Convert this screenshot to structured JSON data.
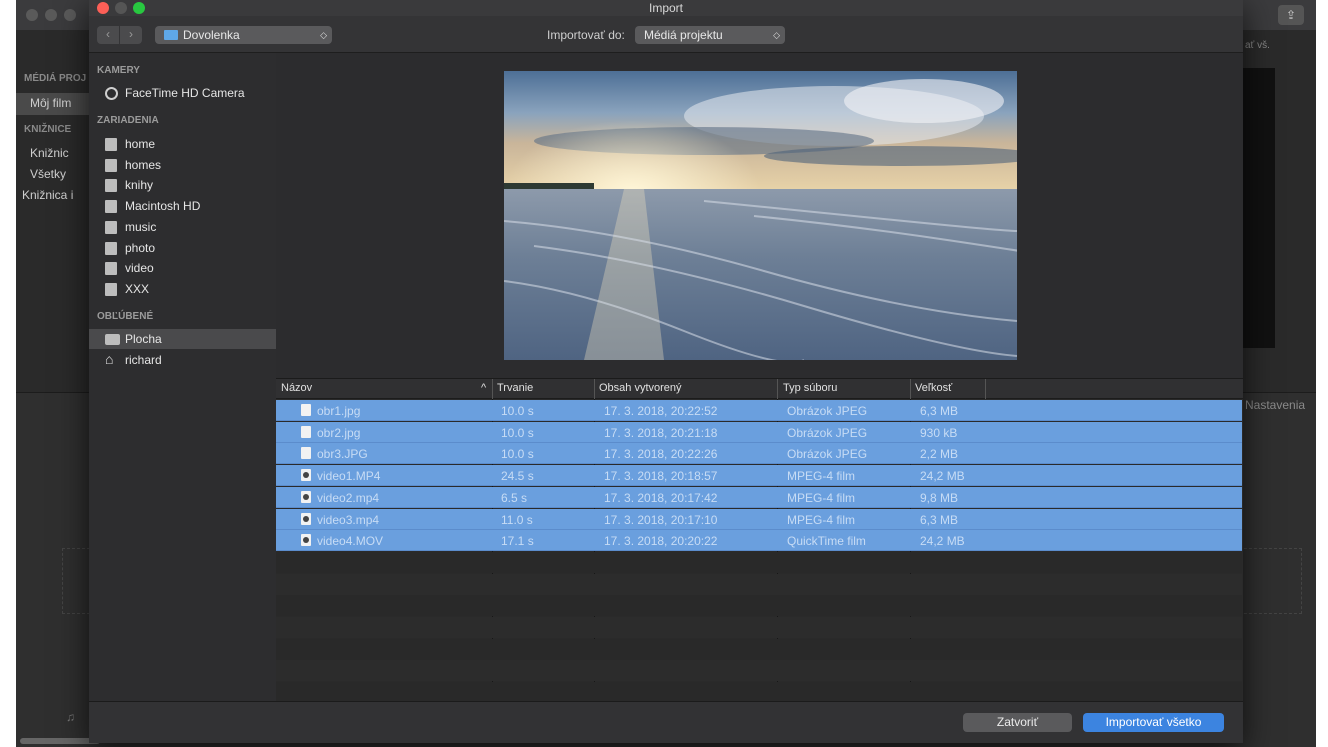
{
  "background_app": {
    "sidebar_sections": [
      "MÉDIÁ PROJ",
      "KNIŽNICE"
    ],
    "sidebar_items": [
      "Môj film",
      "Knižnic",
      "Všetky",
      "Knižnica i"
    ],
    "right_text": "ať vš.",
    "settings_label": "Nastavenia",
    "share_icon": "share-icon"
  },
  "dialog": {
    "title": "Import",
    "toolbar": {
      "back_icon": "‹",
      "forward_icon": "›",
      "location": "Dovolenka",
      "import_to_label": "Importovať do:",
      "import_to_value": "Médiá projektu"
    },
    "sidebar": {
      "sections": {
        "cameras": "KAMERY",
        "devices": "ZARIADENIA",
        "favorites": "OBĽÚBENÉ"
      },
      "cameras": [
        "FaceTime HD Camera"
      ],
      "devices": [
        "home",
        "homes",
        "knihy",
        "Macintosh HD",
        "music",
        "photo",
        "video",
        "XXX"
      ],
      "favorites": [
        "Plocha",
        "richard"
      ],
      "selected": "Plocha"
    },
    "table": {
      "columns": [
        "Názov",
        "Trvanie",
        "Obsah vytvorený",
        "Typ súboru",
        "Veľkosť"
      ],
      "sort_indicator": "^",
      "rows": [
        {
          "name": "obr1.jpg",
          "duration": "10.0 s",
          "created": "17. 3. 2018, 20:22:52",
          "type": "Obrázok JPEG",
          "size": "6,3 MB",
          "kind": "image"
        },
        {
          "name": "obr2.jpg",
          "duration": "10.0 s",
          "created": "17. 3. 2018, 20:21:18",
          "type": "Obrázok JPEG",
          "size": "930 kB",
          "kind": "image"
        },
        {
          "name": "obr3.JPG",
          "duration": "10.0 s",
          "created": "17. 3. 2018, 20:22:26",
          "type": "Obrázok JPEG",
          "size": "2,2 MB",
          "kind": "image"
        },
        {
          "name": "video1.MP4",
          "duration": "24.5 s",
          "created": "17. 3. 2018, 20:18:57",
          "type": "MPEG-4 film",
          "size": "24,2 MB",
          "kind": "video"
        },
        {
          "name": "video2.mp4",
          "duration": "6.5 s",
          "created": "17. 3. 2018, 20:17:42",
          "type": "MPEG-4 film",
          "size": "9,8 MB",
          "kind": "video"
        },
        {
          "name": "video3.mp4",
          "duration": "11.0 s",
          "created": "17. 3. 2018, 20:17:10",
          "type": "MPEG-4 film",
          "size": "6,3 MB",
          "kind": "video"
        },
        {
          "name": "video4.MOV",
          "duration": "17.1 s",
          "created": "17. 3. 2018, 20:20:22",
          "type": "QuickTime film",
          "size": "24,2 MB",
          "kind": "video"
        }
      ]
    },
    "footer": {
      "close_label": "Zatvoriť",
      "import_all_label": "Importovať všetko"
    },
    "colors": {
      "selection": "#6a9fde",
      "primary_button": "#3c84e0"
    }
  }
}
